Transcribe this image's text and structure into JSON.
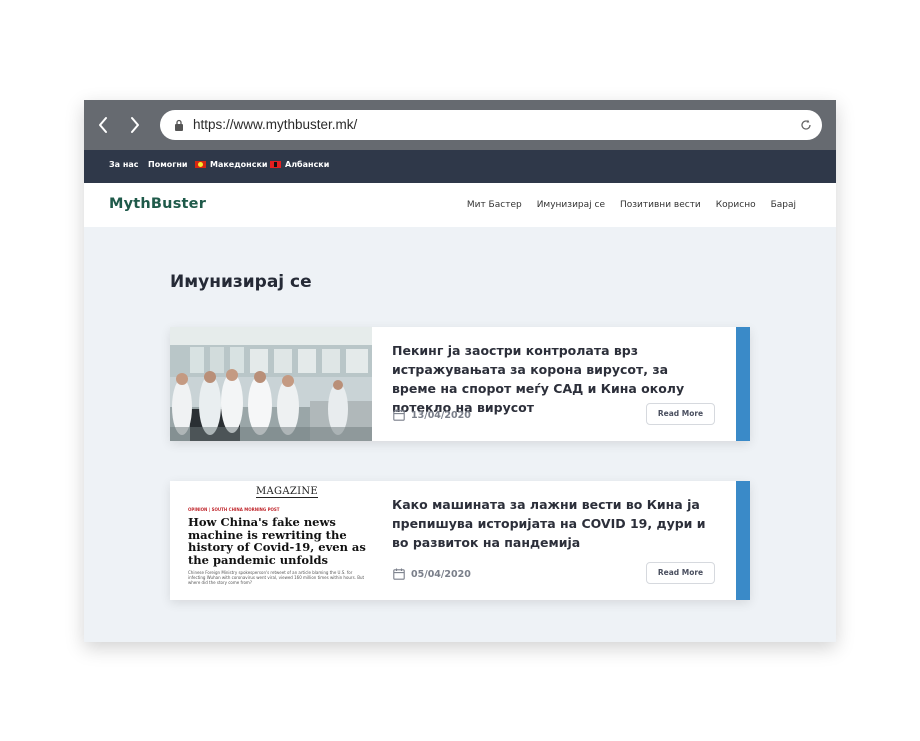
{
  "browser": {
    "url": "https://www.mythbuster.mk/"
  },
  "topbar": {
    "items": [
      "За нас",
      "Помогни",
      "Македонски",
      "Албански"
    ]
  },
  "header": {
    "logo": "MythBuster",
    "nav": [
      "Мит Бастер",
      "Имунизирај се",
      "Позитивни вести",
      "Корисно",
      "Барај"
    ]
  },
  "main": {
    "title": "Имунизирај се",
    "articles": [
      {
        "title": "Пекинг ја заостри контролата врз истражувањата за корона вирусот, за време на спорот меѓу САД и Кина околу потекло на вирусот",
        "date": "13/04/2020",
        "read_more": "Read More"
      },
      {
        "title": "Како машината за лажни вести во Кина ја препишува историјата на COVID 19, дури и во развиток на пандемија",
        "date": "05/04/2020",
        "read_more": "Read More",
        "image": {
          "masthead": "MAGAZINE",
          "kicker": "OPINION | SOUTH CHINA MORNING POST",
          "headline": "How China's fake news machine is rewriting the history of Covid-19, even as the pandemic unfolds",
          "standfirst": "Chinese Foreign Ministry spokesperson's retweet of an article blaming the U.S. for infecting Wuhan with coronavirus went viral, viewed 160 million times within hours. But where did the story come from?"
        }
      }
    ]
  },
  "colors": {
    "topbar": "#2f3849",
    "accent": "#3a8ac8",
    "logo": "#1f5a4a",
    "page_bg": "#eef2f6"
  },
  "icons": [
    "chevron-left-icon",
    "chevron-right-icon",
    "lock-icon",
    "reload-icon",
    "calendar-icon"
  ]
}
